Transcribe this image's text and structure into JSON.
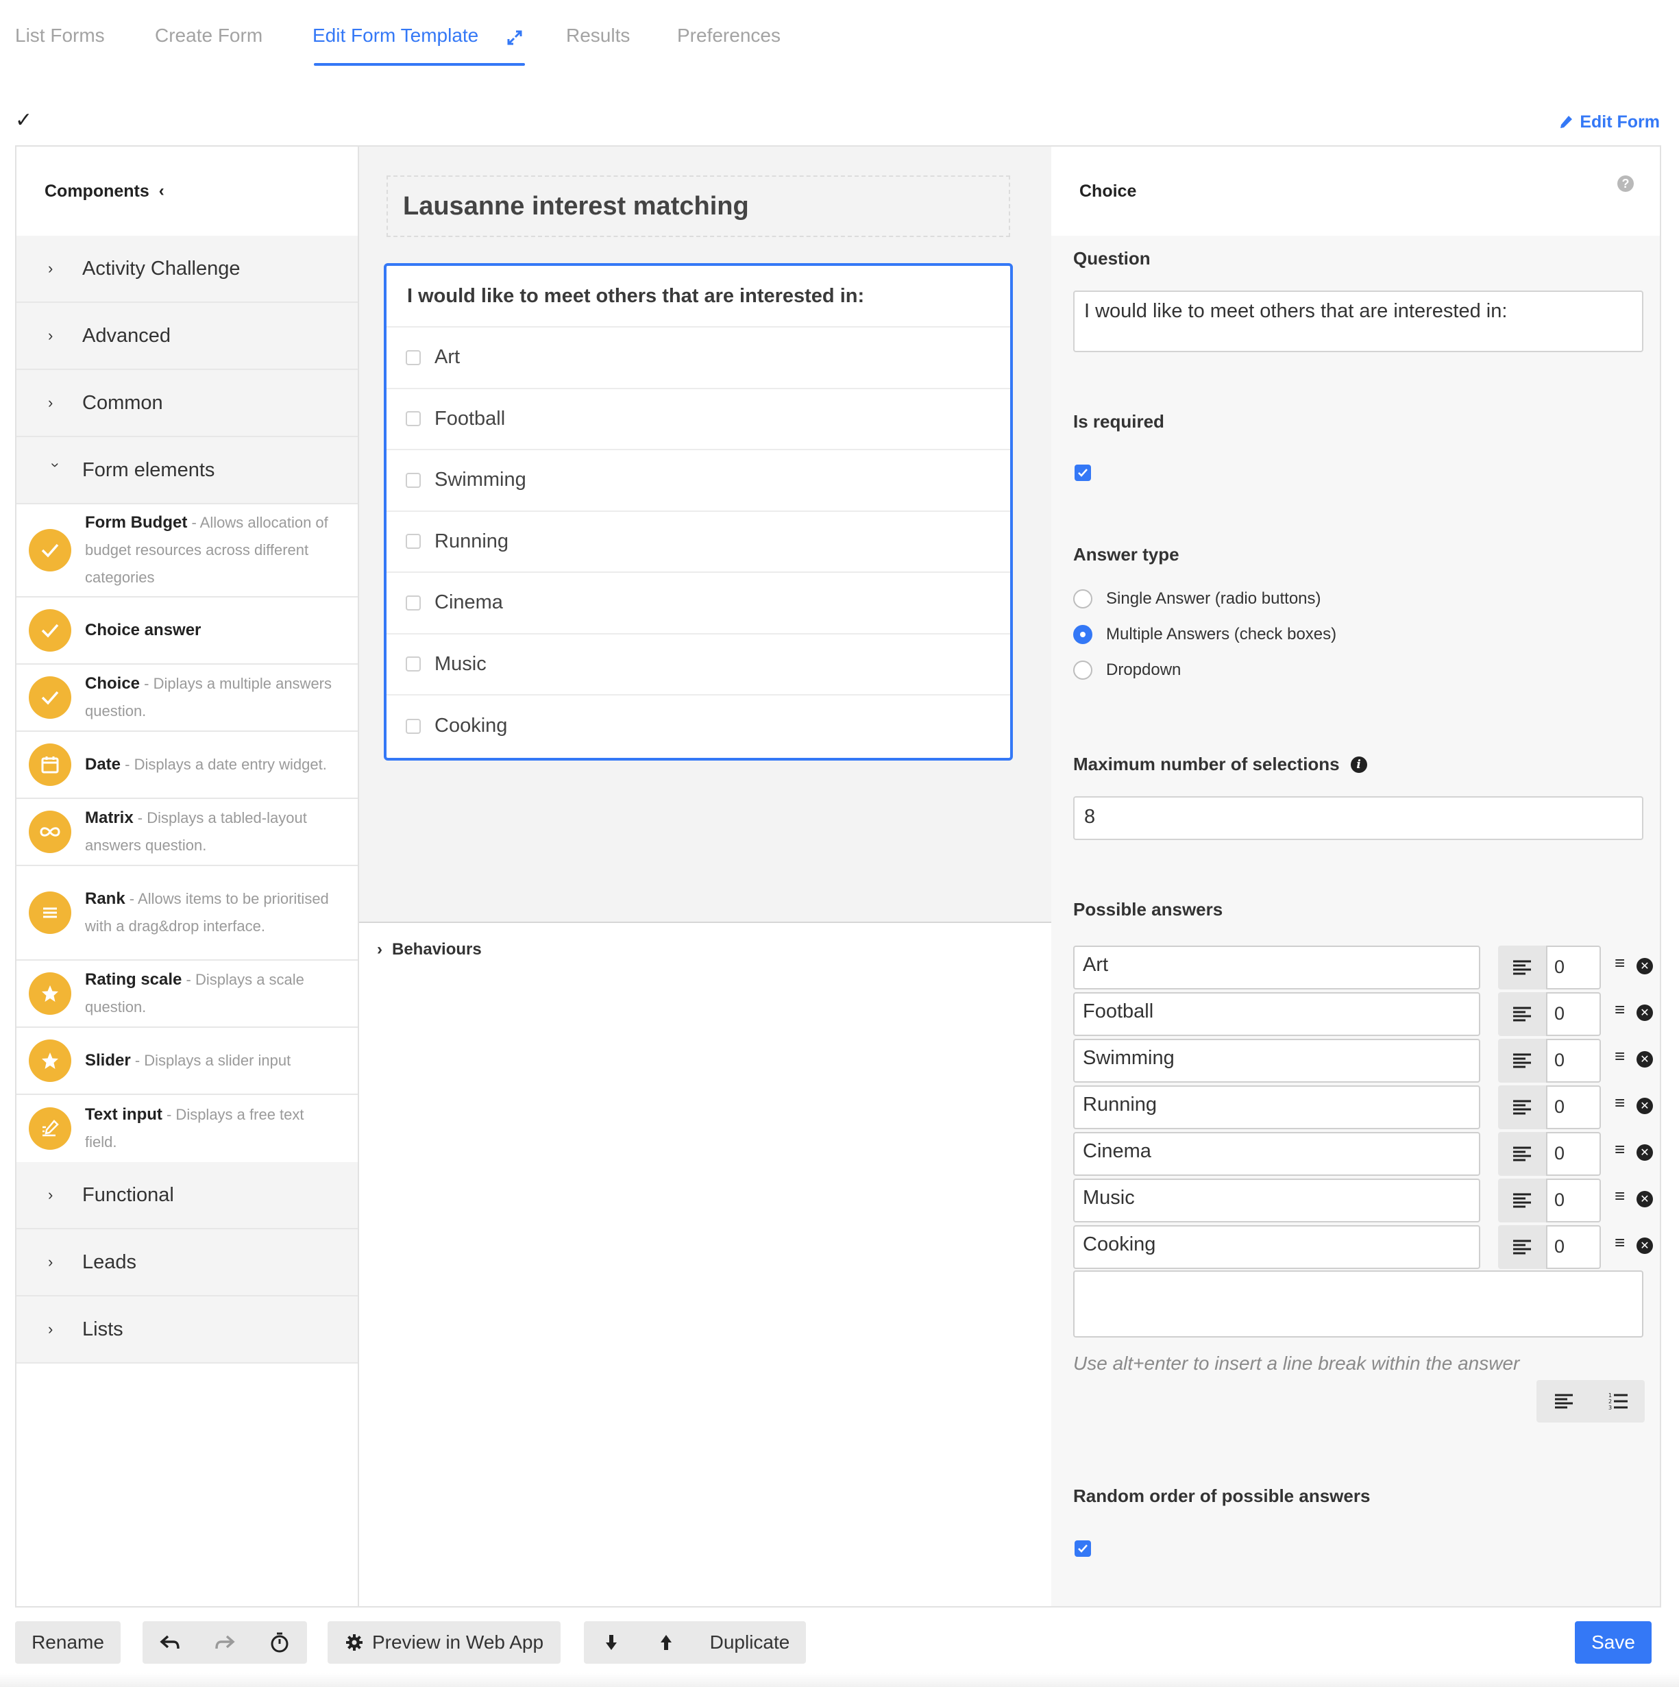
{
  "tabs": {
    "list_forms": "List Forms",
    "create_form": "Create Form",
    "edit_form_template": "Edit Form Template",
    "results": "Results",
    "preferences": "Preferences"
  },
  "status_check": "✓",
  "edit_form_label": "Edit Form",
  "components": {
    "header": "Components",
    "categories_top": [
      "Activity Challenge",
      "Advanced",
      "Common",
      "Form elements"
    ],
    "items": [
      {
        "name": "Form Budget",
        "desc": " - Allows allocation of budget resources across different categories",
        "icon": "check-icon"
      },
      {
        "name": "Choice answer",
        "desc": "",
        "icon": "check-icon"
      },
      {
        "name": "Choice",
        "desc": " - Diplays a multiple answers question.",
        "icon": "check-icon"
      },
      {
        "name": "Date",
        "desc": " - Displays a date entry widget.",
        "icon": "calendar-icon"
      },
      {
        "name": "Matrix",
        "desc": " - Displays a tabled-layout answers question.",
        "icon": "infinity-icon"
      },
      {
        "name": "Rank",
        "desc": " - Allows items to be prioritised with a drag&drop interface.",
        "icon": "list-icon"
      },
      {
        "name": "Rating scale",
        "desc": " - Displays a scale question.",
        "icon": "star-icon"
      },
      {
        "name": "Slider",
        "desc": " - Displays a slider input",
        "icon": "star-icon"
      },
      {
        "name": "Text input",
        "desc": " - Displays a free text field.",
        "icon": "edit-icon"
      }
    ],
    "categories_bottom": [
      "Functional",
      "Leads",
      "Lists"
    ]
  },
  "canvas": {
    "form_title": "Lausanne interest matching",
    "question": "I would like to meet others that are interested in:",
    "options": [
      "Art",
      "Football",
      "Swimming",
      "Running",
      "Cinema",
      "Music",
      "Cooking"
    ],
    "behaviours_label": "Behaviours"
  },
  "properties": {
    "header": "Choice",
    "help_glyph": "?",
    "question_label": "Question",
    "question_value": "I would like to meet others that are interested in:",
    "required_label": "Is required",
    "required_checked": true,
    "answer_type_label": "Answer type",
    "answer_types": [
      "Single Answer (radio buttons)",
      "Multiple Answers (check boxes)",
      "Dropdown"
    ],
    "answer_type_selected": "Multiple Answers (check boxes)",
    "max_selections_label": "Maximum number of selections",
    "max_selections_value": "8",
    "possible_answers_label": "Possible answers",
    "answers": [
      {
        "text": "Art",
        "value": "0"
      },
      {
        "text": "Football",
        "value": "0"
      },
      {
        "text": "Swimming",
        "value": "0"
      },
      {
        "text": "Running",
        "value": "0"
      },
      {
        "text": "Cinema",
        "value": "0"
      },
      {
        "text": "Music",
        "value": "0"
      },
      {
        "text": "Cooking",
        "value": "0"
      }
    ],
    "hint": "Use alt+enter to insert a line break within the answer",
    "random_order_label": "Random order of possible answers",
    "random_order_checked": true
  },
  "toolbar": {
    "rename": "Rename",
    "preview": "Preview in Web App",
    "duplicate": "Duplicate",
    "save": "Save"
  },
  "colors": {
    "accent": "#3478f6",
    "component_icon": "#f2b535"
  }
}
